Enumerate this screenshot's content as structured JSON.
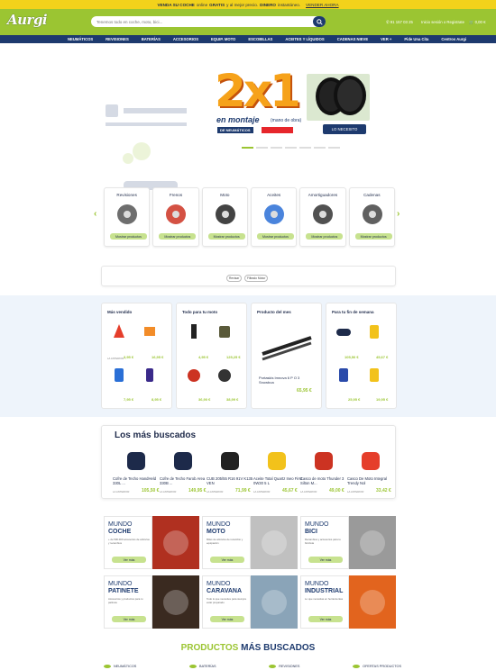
{
  "topbar": {
    "pre": "VENDA SU COCHE",
    "mid1": "online",
    "gratis": "GRATIS",
    "mid2": "y al mejor precio.",
    "dinero": "DINERO",
    "mid3": "instantáneo.",
    "cta": "VENDER AHORA"
  },
  "header": {
    "logo": "Aurgi",
    "search_placeholder": "Tenemos todo en coche, moto, bici...",
    "phone": "91 157 03 25",
    "login": "Inicio sesión o Registrate",
    "cart": "0,00 €"
  },
  "nav": [
    "NEUMÁTICOS",
    "REVISIONES",
    "BATERÍAS",
    "ACCESORIOS",
    "EQUIP. MOTO",
    "ESCOBILLAS",
    "ACEITES Y LÍQUIDOS",
    "CADENAS NIEVE",
    "VER +",
    "Pide Una Cita",
    "Centros Aurgi"
  ],
  "hero": {
    "big": "2x1",
    "line1": "en montaje",
    "line1b": "(mano de obra)",
    "tag": "DE NEUMÁTICOS",
    "cta": "LO NECESITO"
  },
  "categories": [
    {
      "title": "Revisiones",
      "button": "Mostrar productos",
      "icon": "car-lift-icon"
    },
    {
      "title": "Frenos",
      "button": "Mostrar productos",
      "icon": "brake-disc-icon"
    },
    {
      "title": "Moto",
      "button": "Mostrar productos",
      "icon": "motorcycle-icon"
    },
    {
      "title": "Aceites",
      "button": "Mostrar productos",
      "icon": "oil-can-icon"
    },
    {
      "title": "Amortiguadores",
      "button": "Mostrar productos",
      "icon": "shock-absorber-icon"
    },
    {
      "title": "Cadenas",
      "button": "Mostrar productos",
      "icon": "snow-chain-icon"
    }
  ],
  "tags": [
    "Revisar",
    "Filtrado Motor"
  ],
  "columns": {
    "c1": {
      "title": "Más vendido",
      "prices": [
        "3,95 €",
        "16,95 €",
        "7,95 €",
        "8,95 €"
      ]
    },
    "c2": {
      "title": "Todo para tu moto",
      "prices": [
        "4,95 €",
        "125,25 €",
        "36,90 €",
        "38,99 €"
      ]
    },
    "c3": {
      "title": "Producto del mes",
      "name": "Portaskis Imnova 6 P O 3 Snowboa",
      "price": "65,95 €"
    },
    "c4": {
      "title": "Para tu fin de semana",
      "prices": [
        "105,50 €",
        "45,67 €",
        "25,95 €",
        "19,95 €"
      ]
    },
    "old_label": "LA ANTERIOR"
  },
  "mas_buscados": {
    "title": "Los más buscados",
    "items": [
      {
        "name": "Cofre de Techo HandHeld 330L ...",
        "old": "LA ANTERIOR",
        "price": "105,50 €"
      },
      {
        "name": "Cofre de Techo Farob Area 330B ...",
        "old": "LA ANTERIOR",
        "price": "149,95 €"
      },
      {
        "name": "CUB 205/55 R16 91V K135 VEN",
        "old": "LA ANTERIOR",
        "price": "71,99 €"
      },
      {
        "name": "Aceite Total Quartz Ineo First 0W30 5 L",
        "old": "LA ANTERIOR",
        "price": "45,67 €"
      },
      {
        "name": "Casco de moto Thunder 3 Silton M...",
        "old": "LA ANTERIOR",
        "price": "49,00 €"
      },
      {
        "name": "Casco De Moto Integral Trendy Nol",
        "old": "LA ANTERIOR",
        "price": "33,42 €"
      }
    ]
  },
  "mundos": [
    {
      "w1": "MUNDO",
      "w2": "COCHE",
      "desc": "+ de 500.000 accesorios de artículos y recambios",
      "btn": "Ver más"
    },
    {
      "w1": "MUNDO",
      "w2": "MOTO",
      "desc": "Miles de artículos de recambio y equipación",
      "btn": "Ver más"
    },
    {
      "w1": "MUNDO",
      "w2": "BICI",
      "desc": "Recambios y accesorios para tu bicicleta",
      "btn": "Ver más"
    },
    {
      "w1": "MUNDO",
      "w2": "PATINETE",
      "desc": "Accesorios y productos para tu patinete",
      "btn": "Ver más"
    },
    {
      "w1": "MUNDO",
      "w2": "CARAVANA",
      "desc": "Todo lo que necesites para siempre estar preparado",
      "btn": "Ver más"
    },
    {
      "w1": "MUNDO",
      "w2": "INDUSTRIAL",
      "desc": "Lo que necesitas en herramientas",
      "btn": "Ver más"
    }
  ],
  "productos": {
    "a": "PRODUCTOS",
    "b": "MÁS BUSCADOS"
  },
  "bottom_tabs": [
    "NEUMÁTICOS",
    "BATERÍAS",
    "REVISIONES",
    "OFERTAS PRODUCTOS"
  ],
  "colors": {
    "green": "#9bc532",
    "navy": "#1d3a6e",
    "yellow": "#f2d21b"
  }
}
